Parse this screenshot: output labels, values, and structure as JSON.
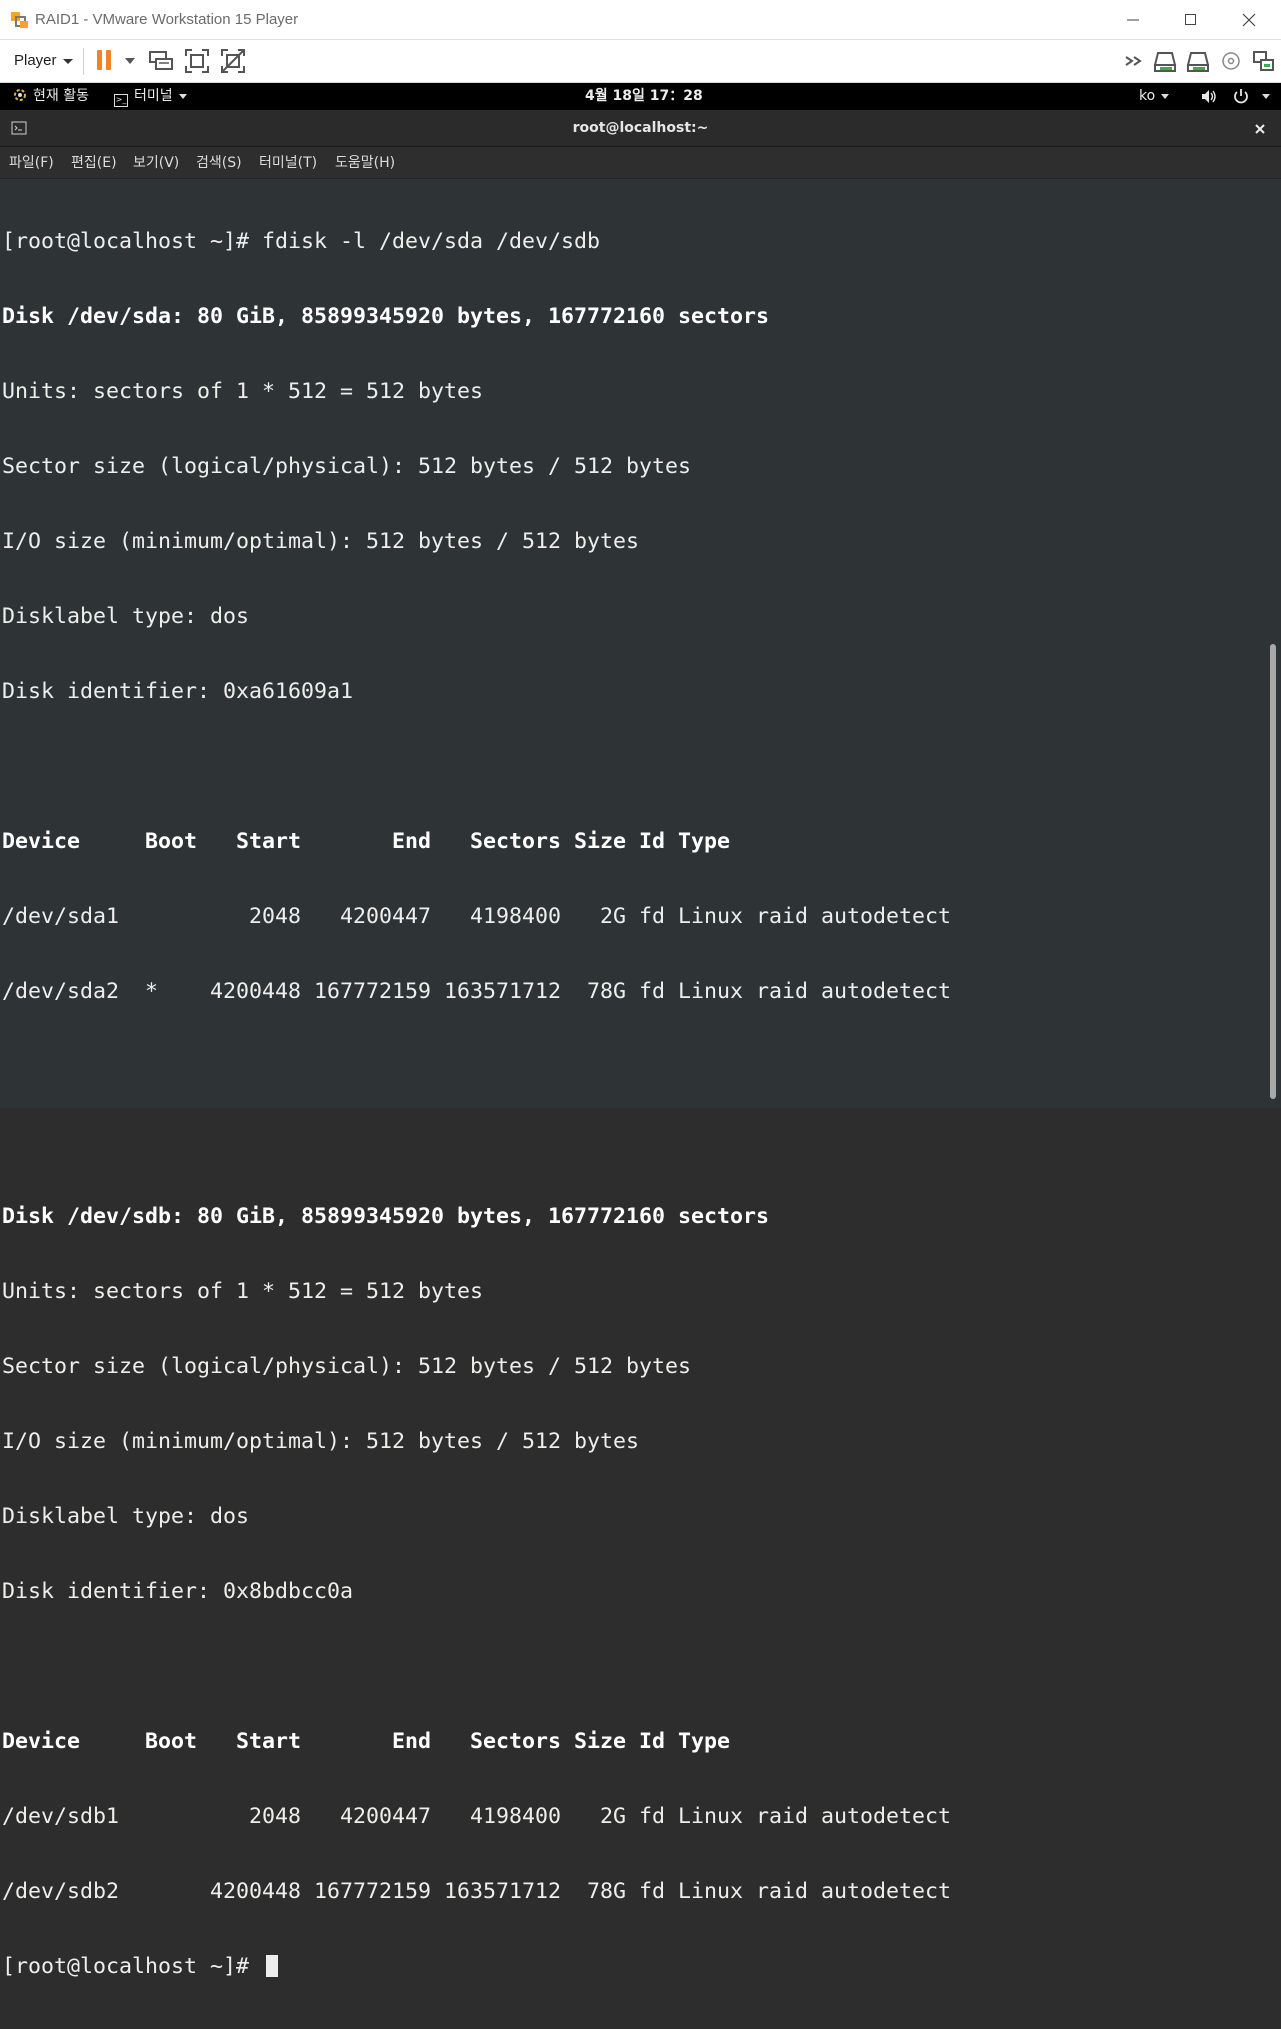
{
  "window": {
    "title": "RAID1 - VMware Workstation 15 Player",
    "controls": [
      "minimize",
      "maximize",
      "close"
    ]
  },
  "toolbar": {
    "player_label": "Player",
    "buttons": [
      "pause-icon",
      "send-ctrl-alt-del-icon",
      "fullscreen-icon",
      "unity-icon"
    ],
    "device_icons": [
      "more-devices-icon",
      "hard-disk-icon",
      "hard-disk-icon",
      "cd-dvd-icon",
      "network-icon"
    ]
  },
  "gnome": {
    "activities": "현재 활동",
    "app_menu": "터미널",
    "clock": "4월 18일  17：28",
    "input_method": "ko"
  },
  "terminal": {
    "title": "root@localhost:~",
    "menu": [
      "파일(F)",
      "편집(E)",
      "보기(V)",
      "검색(S)",
      "터미널(T)",
      "도움말(H)"
    ],
    "lines": [
      "[root@localhost ~]# fdisk -l /dev/sda /dev/sdb",
      "Disk /dev/sda: 80 GiB, 85899345920 bytes, 167772160 sectors",
      "Units: sectors of 1 * 512 = 512 bytes",
      "Sector size (logical/physical): 512 bytes / 512 bytes",
      "I/O size (minimum/optimal): 512 bytes / 512 bytes",
      "Disklabel type: dos",
      "Disk identifier: 0xa61609a1",
      "",
      "Device     Boot   Start       End   Sectors Size Id Type",
      "/dev/sda1          2048   4200447   4198400   2G fd Linux raid autodetect",
      "/dev/sda2  *    4200448 167772159 163571712  78G fd Linux raid autodetect",
      "",
      "",
      "Disk /dev/sdb: 80 GiB, 85899345920 bytes, 167772160 sectors",
      "Units: sectors of 1 * 512 = 512 bytes",
      "Sector size (logical/physical): 512 bytes / 512 bytes",
      "I/O size (minimum/optimal): 512 bytes / 512 bytes",
      "Disklabel type: dos",
      "Disk identifier: 0x8bdbcc0a",
      "",
      "Device     Boot   Start       End   Sectors Size Id Type",
      "/dev/sdb1          2048   4200447   4198400   2G fd Linux raid autodetect",
      "/dev/sdb2       4200448 167772159 163571712  78G fd Linux raid autodetect"
    ],
    "prompt": "[root@localhost ~]# "
  },
  "colors": {
    "terminal_bg": "#2e3436",
    "terminal_fg": "#eeeeec",
    "pause_orange": "#f0822a"
  }
}
